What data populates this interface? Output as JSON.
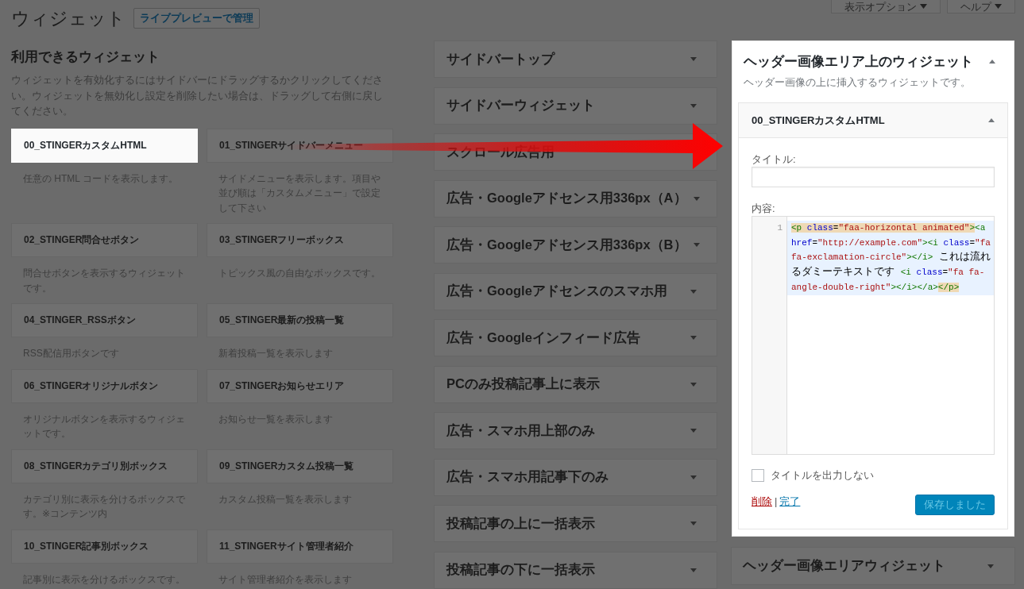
{
  "page": {
    "title": "ウィジェット",
    "manage_button": "ライブプレビューで管理"
  },
  "screen_options": [
    {
      "label": "表示オプション"
    },
    {
      "label": "ヘルプ"
    }
  ],
  "available_widgets": {
    "heading": "利用できるウィジェット",
    "description": "ウィジェットを有効化するにはサイドバーにドラッグするかクリックしてください。ウィジェットを無効化し設定を削除したい場合は、ドラッグして右側に戻してください。",
    "widgets": [
      {
        "title": "00_STINGERカスタムHTML",
        "description": "任意の HTML コードを表示します。",
        "selected": true
      },
      {
        "title": "01_STINGERサイドバーメニュー",
        "description": "サイドメニューを表示します。項目や並び順は「カスタムメニュー」で設定して下さい",
        "selected": false
      },
      {
        "title": "02_STINGER問合せボタン",
        "description": "問合せボタンを表示するウィジェットです。",
        "selected": false
      },
      {
        "title": "03_STINGERフリーボックス",
        "description": "トピックス風の自由なボックスです。",
        "selected": false
      },
      {
        "title": "04_STINGER_RSSボタン",
        "description": "RSS配信用ボタンです",
        "selected": false
      },
      {
        "title": "05_STINGER最新の投稿一覧",
        "description": "新着投稿一覧を表示します",
        "selected": false
      },
      {
        "title": "06_STINGERオリジナルボタン",
        "description": "オリジナルボタンを表示するウィジェットです。",
        "selected": false
      },
      {
        "title": "07_STINGERお知らせエリア",
        "description": "お知らせ一覧を表示します",
        "selected": false
      },
      {
        "title": "08_STINGERカテゴリ別ボックス",
        "description": "カテゴリ別に表示を分けるボックスです。※コンテンツ内",
        "selected": false
      },
      {
        "title": "09_STINGERカスタム投稿一覧",
        "description": "カスタム投稿一覧を表示します",
        "selected": false
      },
      {
        "title": "10_STINGER記事別ボックス",
        "description": "記事別に表示を分けるボックスです。",
        "selected": false
      },
      {
        "title": "11_STINGERサイト管理者紹介",
        "description": "サイト管理者紹介を表示します",
        "selected": false
      }
    ]
  },
  "sidebar_columns": [
    {
      "sidebars": [
        {
          "title": "サイドバートップ",
          "expanded": false
        },
        {
          "title": "サイドバーウィジェット",
          "expanded": false
        },
        {
          "title": "スクロール広告用",
          "expanded": false
        },
        {
          "title": "広告・Googleアドセンス用336px（A）",
          "expanded": false
        },
        {
          "title": "広告・Googleアドセンス用336px（B）",
          "expanded": false
        },
        {
          "title": "広告・Googleアドセンスのスマホ用",
          "expanded": false
        },
        {
          "title": "広告・Googleインフィード広告",
          "expanded": false
        },
        {
          "title": "PCのみ投稿記事上に表示",
          "expanded": false
        },
        {
          "title": "広告・スマホ用上部のみ",
          "expanded": false
        },
        {
          "title": "広告・スマホ用記事下のみ",
          "expanded": false
        },
        {
          "title": "投稿記事の上に一括表示",
          "expanded": false
        },
        {
          "title": "投稿記事の下に一括表示",
          "expanded": false
        }
      ]
    },
    {
      "sidebars": [
        {
          "title": "ヘッダー画像エリア上のウィジェット",
          "expanded": true,
          "description": "ヘッダー画像の上に挿入するウィジェットです。",
          "widgets": [
            {
              "title": "00_STINGERカスタムHTML",
              "expanded": true,
              "title_field": {
                "label": "タイトル:"
              },
              "content_field": {
                "label": "内容:",
                "line_number": "1",
                "tokens": [
                  {
                    "kind": "tag",
                    "text": "<p",
                    "matched": true
                  },
                  {
                    "kind": "attribute",
                    "text": " class",
                    "matched": true
                  },
                  {
                    "kind": "plain",
                    "text": "=",
                    "matched": true
                  },
                  {
                    "kind": "string",
                    "text": "\"faa-horizontal animated\"",
                    "matched": true
                  },
                  {
                    "kind": "tag",
                    "text": ">",
                    "matched": true
                  },
                  {
                    "kind": "tag",
                    "text": "<a",
                    "matched": false
                  },
                  {
                    "kind": "attribute",
                    "text": " href",
                    "matched": false
                  },
                  {
                    "kind": "plain",
                    "text": "=",
                    "matched": false
                  },
                  {
                    "kind": "string",
                    "text": "\"http://example.com\"",
                    "matched": false
                  },
                  {
                    "kind": "tag",
                    "text": "><i",
                    "matched": false
                  },
                  {
                    "kind": "attribute",
                    "text": " class",
                    "matched": false
                  },
                  {
                    "kind": "plain",
                    "text": "=",
                    "matched": false
                  },
                  {
                    "kind": "string",
                    "text": "\"fa fa-exclamation-circle\"",
                    "matched": false
                  },
                  {
                    "kind": "tag",
                    "text": "></i>",
                    "matched": false
                  },
                  {
                    "kind": "text",
                    "text": " これは流れるダミーテキストです ",
                    "matched": false
                  },
                  {
                    "kind": "tag",
                    "text": "<i",
                    "matched": false
                  },
                  {
                    "kind": "attribute",
                    "text": " class",
                    "matched": false
                  },
                  {
                    "kind": "plain",
                    "text": "=",
                    "matched": false
                  },
                  {
                    "kind": "string",
                    "text": "\"fa fa-angle-double-right\"",
                    "matched": false
                  },
                  {
                    "kind": "tag",
                    "text": "></i></a>",
                    "matched": false
                  },
                  {
                    "kind": "tag",
                    "text": "</p>",
                    "matched": true
                  }
                ]
              },
              "hide_title": {
                "label": "タイトルを出力しない",
                "checked": false
              },
              "delete_link": "削除",
              "separator": "|",
              "done_link": "完了",
              "save_button": {
                "label": "保存しました",
                "disabled": true
              }
            }
          ]
        },
        {
          "title": "ヘッダー画像エリアウィジェット",
          "expanded": false
        }
      ]
    }
  ]
}
